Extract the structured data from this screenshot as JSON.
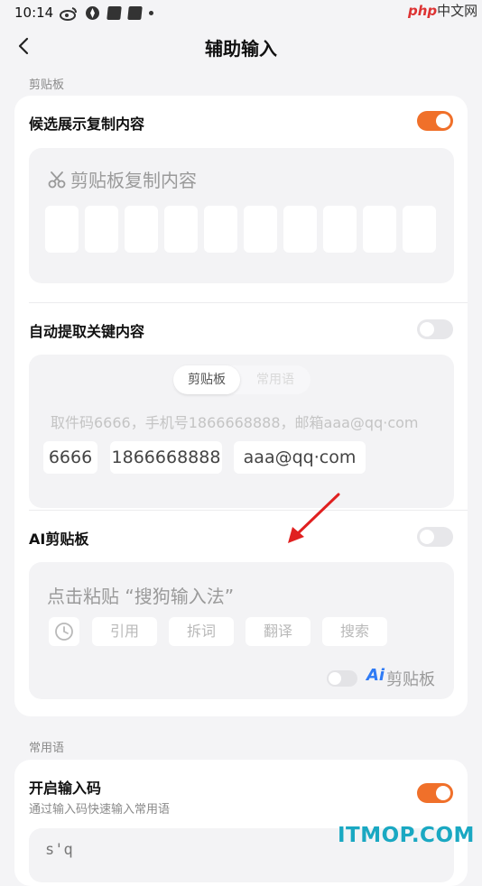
{
  "status": {
    "time": "10:14"
  },
  "watermark": {
    "top_brand": "php",
    "top_suffix": "中文网",
    "bottom": "ITMOP.COM"
  },
  "header": {
    "title": "辅助输入"
  },
  "sections": {
    "clipboard_label": "剪贴板",
    "phrases_label": "常用语"
  },
  "candidate": {
    "title": "候选展示复制内容",
    "enabled": true,
    "preview_title": "剪贴板复制内容"
  },
  "extract": {
    "title": "自动提取关键内容",
    "enabled": false,
    "tabs": [
      "剪贴板",
      "常用语"
    ],
    "sample_text": "取件码6666，手机号1866668888，邮箱aaa@qq·com",
    "chips": [
      "6666",
      "1866668888",
      "aaa@qq·com"
    ]
  },
  "ai": {
    "title": "AI剪贴板",
    "enabled": false,
    "paste_hint": "点击粘贴 “搜狗输入法”",
    "actions": [
      "引用",
      "拆词",
      "翻译",
      "搜索"
    ],
    "badge_prefix": "Ai",
    "badge_label": "剪贴板"
  },
  "input_code": {
    "title": "开启输入码",
    "subtitle": "通过输入码快速输入常用语",
    "enabled": true,
    "preview_text": "s'q"
  },
  "colors": {
    "accent": "#f0702a",
    "ai_blue": "#2f7bf5",
    "arrow": "#e02020"
  }
}
